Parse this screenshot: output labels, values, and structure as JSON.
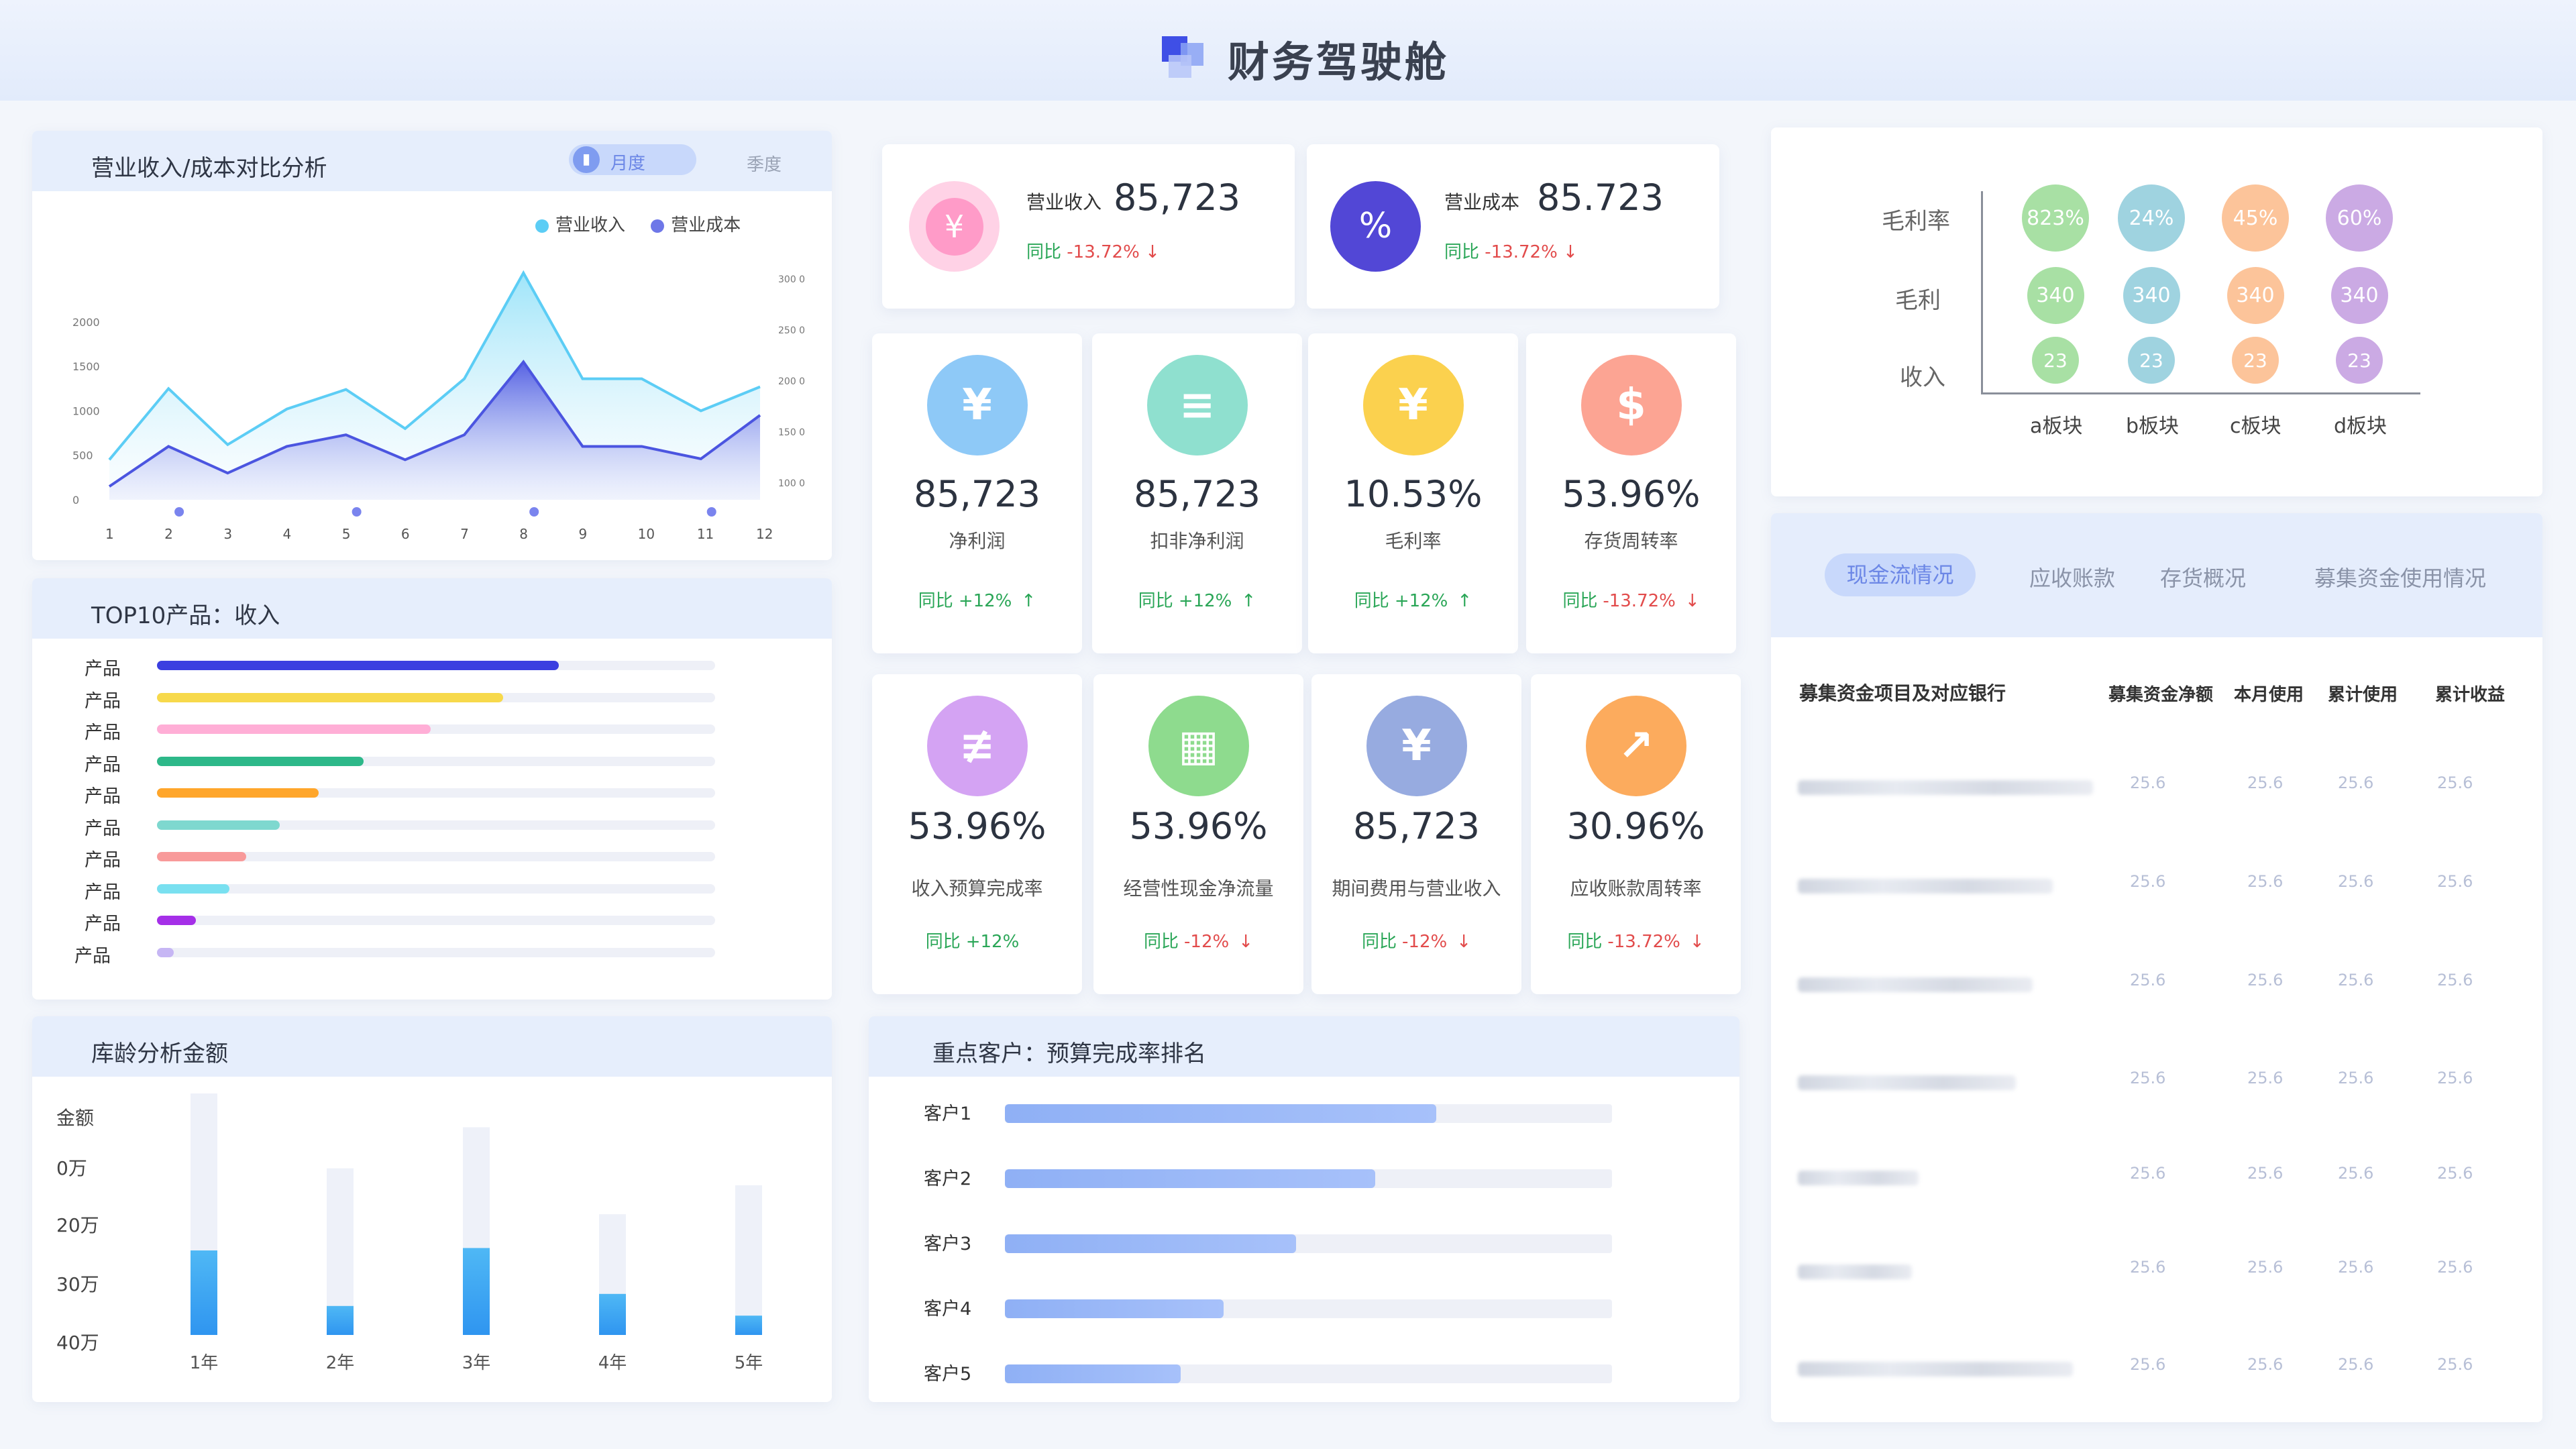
{
  "app": {
    "title": "财务驾驶舱"
  },
  "revenue_panel": {
    "title": "营业收入/成本对比分析",
    "seg_month": "月度",
    "seg_quarter": "季度",
    "legend_revenue": "营业收入",
    "legend_cost": "营业成本",
    "colors": {
      "revenue": "#5ccdf5",
      "cost": "#4b55e0"
    }
  },
  "top10": {
    "title": "TOP10产品：收入",
    "items": [
      {
        "label": "产品",
        "value": 0.72,
        "color": "#3b3fe0"
      },
      {
        "label": "产品",
        "value": 0.62,
        "color": "#f7d94b"
      },
      {
        "label": "产品",
        "value": 0.49,
        "color": "#ffaed6"
      },
      {
        "label": "产品",
        "value": 0.37,
        "color": "#2db889"
      },
      {
        "label": "产品",
        "value": 0.29,
        "color": "#ffa62b"
      },
      {
        "label": "产品",
        "value": 0.22,
        "color": "#7ed8cf"
      },
      {
        "label": "产品",
        "value": 0.16,
        "color": "#f89a9a"
      },
      {
        "label": "产品",
        "value": 0.13,
        "color": "#79e0f0"
      },
      {
        "label": "产品",
        "value": 0.07,
        "color": "#a52fe8"
      },
      {
        "label": "产品",
        "value": 0.03,
        "color": "#c6b6f4"
      }
    ]
  },
  "aging": {
    "title": "库龄分析金额",
    "y_title": "金额",
    "y_labels": [
      "0万",
      "20万",
      "30万",
      "40万"
    ]
  },
  "summary": [
    {
      "label": "营业收入",
      "value": "85,723",
      "cmp_label": "同比",
      "cmp_value": "-13.72%",
      "arrow": "↓"
    },
    {
      "label": "营业成本",
      "value": "85.723",
      "cmp_label": "同比",
      "cmp_value": "-13.72%",
      "arrow": "↓"
    }
  ],
  "kpis": [
    {
      "value": "85,723",
      "label": "净利润",
      "cmp_label": "同比",
      "cmp_value": "+12%",
      "arrow": "↑",
      "icon": "yen-shield-icon",
      "glyph": "¥",
      "color": "#8ec9f7"
    },
    {
      "value": "85,723",
      "label": "扣非净利润",
      "cmp_label": "同比",
      "cmp_value": "+12%",
      "arrow": "↑",
      "icon": "document-icon",
      "glyph": "≡",
      "color": "#8fe0cf"
    },
    {
      "value": "10.53%",
      "label": "毛利率",
      "cmp_label": "同比",
      "cmp_value": "+12%",
      "arrow": "↑",
      "icon": "clipboard-icon",
      "glyph": "¥",
      "color": "#fbd14e"
    },
    {
      "value": "53.96%",
      "label": "存货周转率",
      "cmp_label": "同比",
      "cmp_value": "-13.72%",
      "arrow": "↓",
      "icon": "dollar-icon",
      "glyph": "$",
      "color": "#fca493"
    },
    {
      "value": "53.96%",
      "label": "收入预算完成率",
      "cmp_label": "同比",
      "cmp_value": "+12%",
      "arrow": "",
      "icon": "budget-icon",
      "glyph": "≢",
      "color": "#d4a3f3"
    },
    {
      "value": "53.96%",
      "label": "经营性现金净流量",
      "cmp_label": "同比",
      "cmp_value": "-12%",
      "arrow": "↓",
      "icon": "cash-flow-icon",
      "glyph": "▦",
      "color": "#8edb8e"
    },
    {
      "value": "85,723",
      "label": "期间费用与营业收入",
      "cmp_label": "同比",
      "cmp_value": "-12%",
      "arrow": "↓",
      "icon": "coins-icon",
      "glyph": "¥",
      "color": "#97abe0"
    },
    {
      "value": "30.96%",
      "label": "应收账款周转率",
      "cmp_label": "同比",
      "cmp_value": "-13.72%",
      "arrow": "↓",
      "icon": "trend-icon",
      "glyph": "↗",
      "color": "#fcab5d"
    }
  ],
  "customers": {
    "title": "重点客户：预算完成率排名",
    "items": [
      {
        "label": "客户1",
        "value": 0.71
      },
      {
        "label": "客户2",
        "value": 0.61
      },
      {
        "label": "客户3",
        "value": 0.48
      },
      {
        "label": "客户4",
        "value": 0.36
      },
      {
        "label": "客户5",
        "value": 0.29
      }
    ]
  },
  "bubbles": {
    "row_labels": [
      "毛利率",
      "毛利",
      "收入"
    ],
    "col_labels": [
      "a板块",
      "b板块",
      "c板块",
      "d板块"
    ],
    "colors": [
      "#a8e0a4",
      "#9fd3e0",
      "#fcc49a",
      "#cbaae4"
    ],
    "rows": [
      [
        "823%",
        "24%",
        "45%",
        "60%"
      ],
      [
        "340",
        "340",
        "340",
        "340"
      ],
      [
        "23",
        "23",
        "23",
        "23"
      ]
    ]
  },
  "funds": {
    "tabs": [
      "现金流情况",
      "应收账款",
      "存货概况",
      "募集资金使用情况"
    ],
    "headers": [
      "募集资金项目及对应银行",
      "募集资金净额",
      "本月使用",
      "累计使用",
      "累计收益"
    ],
    "rows": [
      [
        "25.6",
        "25.6",
        "25.6",
        "25.6"
      ],
      [
        "25.6",
        "25.6",
        "25.6",
        "25.6"
      ],
      [
        "25.6",
        "25.6",
        "25.6",
        "25.6"
      ],
      [
        "25.6",
        "25.6",
        "25.6",
        "25.6"
      ],
      [
        "25.6",
        "25.6",
        "25.6",
        "25.6"
      ],
      [
        "25.6",
        "25.6",
        "25.6",
        "25.6"
      ],
      [
        "25.6",
        "25.6",
        "25.6",
        "25.6"
      ]
    ]
  },
  "chart_data": [
    {
      "type": "area",
      "title": "营业收入/成本对比分析",
      "x": [
        1,
        2,
        3,
        4,
        5,
        6,
        7,
        8,
        9,
        10,
        11,
        12
      ],
      "ylim": [
        0,
        2000
      ],
      "y_ticks": [
        0,
        500,
        1000,
        1500,
        2000
      ],
      "y2_ticks": [
        "100 0",
        "150 0",
        "200 0",
        "250 0",
        "300 0"
      ],
      "series": [
        {
          "name": "营业收入",
          "values": [
            450,
            1250,
            620,
            1020,
            1240,
            800,
            1360,
            2550,
            1360,
            1360,
            1000,
            1270
          ]
        },
        {
          "name": "营业成本",
          "values": [
            150,
            600,
            300,
            600,
            730,
            450,
            730,
            1550,
            600,
            600,
            460,
            950
          ]
        }
      ]
    },
    {
      "type": "bar",
      "title": "库龄分析金额",
      "categories": [
        "1年",
        "2年",
        "3年",
        "4年",
        "5年"
      ],
      "values": [
        0.35,
        0.12,
        0.36,
        0.17,
        0.08
      ],
      "totals": [
        1.0,
        0.69,
        0.86,
        0.5,
        0.62
      ]
    }
  ]
}
